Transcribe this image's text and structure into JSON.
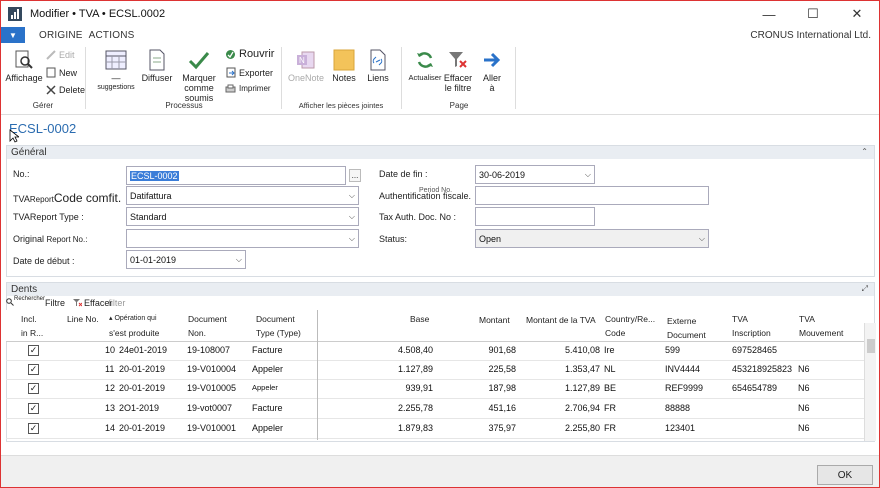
{
  "window": {
    "title": "Modifier • TVA • ECSL.0002",
    "minimize": "—",
    "maximize": "☐",
    "close": "✕"
  },
  "menu": {
    "button": "▼",
    "tabs": [
      "ORIGINE",
      "ACTIONS"
    ],
    "company": "CRONUS International Ltd."
  },
  "ribbon": {
    "gerer": {
      "label": "Gérer",
      "affichage": "Affichage",
      "edit": "Edit",
      "new": "New",
      "delete": "Delete"
    },
    "processus": {
      "label": "Processus",
      "suggestions": "—\nsuggestions",
      "suggestions_main": "—",
      "suggestions_sub": "suggestions",
      "diffuser": "Diffuser",
      "marquer_1": "Marquer",
      "marquer_2": "comme soumis",
      "rouvrir": "Rouvrir",
      "exporter": "Exporter",
      "imprimer": "Imprimer"
    },
    "pieces": {
      "label": "Afficher les pièces jointes",
      "onenote": "OneNote",
      "notes": "Notes",
      "liens": "Liens"
    },
    "page": {
      "label": "Page",
      "actualiser": "Actualiser",
      "effacer_1": "Effacer",
      "effacer_2": "le filtre",
      "aller_1": "Aller",
      "aller_2": "à"
    }
  },
  "record": {
    "title": "ECSL-0002"
  },
  "general": {
    "header": "Général",
    "no_label": "No.:",
    "no_value": "ECSL-0002",
    "ellipsis": "...",
    "tva_report_label_a": "TVA",
    "tva_report_label_b": "Report",
    "tva_report_label_c": "Code comfit.",
    "tva_report_value": "Datifattura",
    "tva_type_label_a": "TVA",
    "tva_type_label_b": "Report Type :",
    "tva_type_value": "Standard",
    "original_label_a": "Original",
    "original_label_b": "Report No.:",
    "original_value": "",
    "date_debut_label": "Date de début :",
    "date_debut_value": "01-01-2019",
    "date_fin_label": "Date de fin :",
    "date_fin_value": "30-06-2019",
    "auth_label": "Authentification fiscale.",
    "auth_overlay": "Period No.",
    "auth_value": "",
    "tax_auth_label": "Tax Auth. Doc. No :",
    "tax_auth_value": "",
    "status_label": "Status:",
    "status_value": "Open"
  },
  "lines": {
    "header": "Dents",
    "toolbar": {
      "rechercher": "Rechercher",
      "filtre": "Filtre",
      "effacer": "Effacer",
      "filter_overlay": "filter"
    },
    "columns": {
      "incl_1": "Incl.",
      "incl_2": "in R...",
      "line_no": "Line No.",
      "operation_1": "Opération qui",
      "operation_2": "s'est produite",
      "document_1": "Document",
      "document_2": "Non.",
      "doc_type_1": "Document",
      "doc_type_2": "Type (Type)",
      "base": "Base",
      "montant": "Montant",
      "montant_tva": "Montant de la TVA",
      "country_1": "Country/Re...",
      "country_2": "Code",
      "externe_1": "Externe",
      "externe_2": "Document",
      "tva_insc_1": "TVA",
      "tva_insc_2": "Inscription",
      "tva_mouv_1": "TVA",
      "tva_mouv_2": "Mouvement"
    },
    "rows": [
      {
        "incl": "✓",
        "line_no": "10",
        "date": "24e01-2019",
        "doc_no": "19-108007",
        "doc_type": "Facture",
        "base": "4.508,40",
        "montant": "901,68",
        "montant_tva": "5.410,08",
        "country": "Ire",
        "externe": "599",
        "tva_insc": "697528465",
        "tva_mouv": ""
      },
      {
        "incl": "✓",
        "line_no": "11",
        "date": "20-01-2019",
        "doc_no": "19-V010004",
        "doc_type": "Appeler",
        "base": "1.127,89",
        "montant": "225,58",
        "montant_tva": "1.353,47",
        "country": "NL",
        "externe": "INV4444",
        "tva_insc": "453218925823",
        "tva_mouv": "N6"
      },
      {
        "incl": "✓",
        "line_no": "12",
        "date": "20-01-2019",
        "doc_no": "19-V010005",
        "doc_type": "Appeler",
        "base": "939,91",
        "montant": "187,98",
        "montant_tva": "1.127,89",
        "country": "BE",
        "externe": "REF9999",
        "tva_insc": "654654789",
        "tva_mouv": "N6"
      },
      {
        "incl": "✓",
        "line_no": "13",
        "date": "2O1-2019",
        "doc_no": "19-vot0007",
        "doc_type": "Facture",
        "base": "2.255,78",
        "montant": "451,16",
        "montant_tva": "2.706,94",
        "country": "FR",
        "externe": "88888",
        "tva_insc": "",
        "tva_mouv": "N6"
      },
      {
        "incl": "✓",
        "line_no": "14",
        "date": "20-01-2019",
        "doc_no": "19-V010001",
        "doc_type": "Appeler",
        "base": "1.879,83",
        "montant": "375,97",
        "montant_tva": "2.255,80",
        "country": "FR",
        "externe": "123401",
        "tva_insc": "",
        "tva_mouv": "N6"
      }
    ]
  },
  "footer": {
    "ok": "OK"
  },
  "colors": {
    "accent": "#2a72c9",
    "border": "#d33333",
    "title": "#2b6cb0"
  }
}
